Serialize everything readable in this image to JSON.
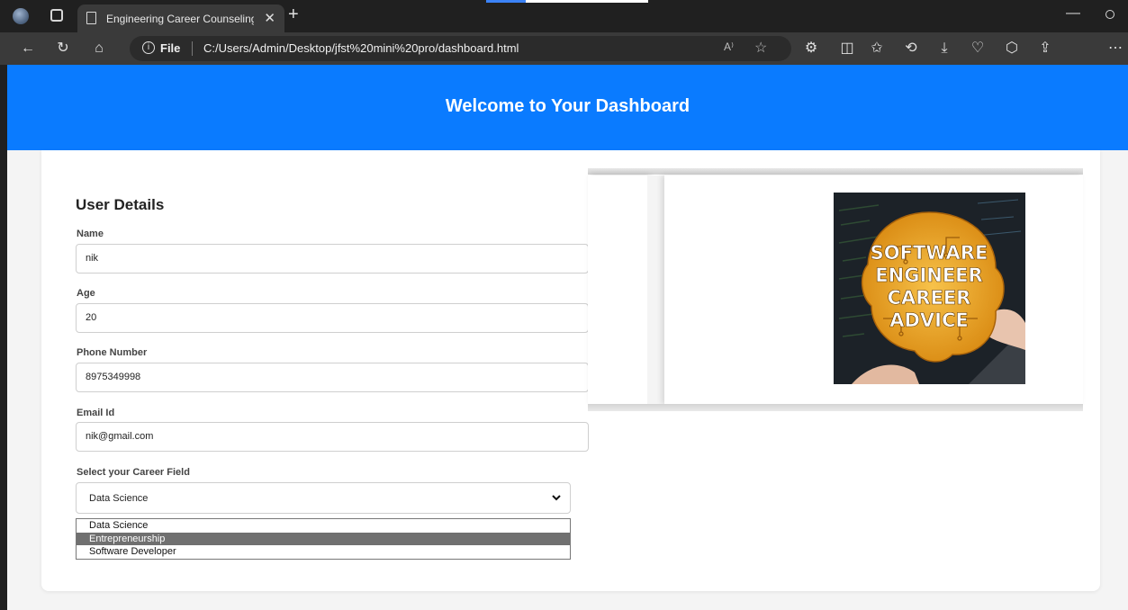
{
  "browser": {
    "tab_title": "Engineering Career Counseling D",
    "tab_close": "✕",
    "new_tab": "+",
    "file_label": "File",
    "url": "C:/Users/Admin/Desktop/jfst%20mini%20pro/dashboard.html",
    "icons": [
      "back-icon",
      "refresh-icon",
      "home-icon",
      "read-aloud-icon",
      "favorite-icon",
      "extensions-icon",
      "split-screen-icon",
      "favorites-icon",
      "history-icon",
      "downloads-icon",
      "performance-icon",
      "browser-essentials-icon",
      "share-icon",
      "more-icon"
    ]
  },
  "page": {
    "header_title": "Welcome to Your Dashboard",
    "header_color": "#0a7bff",
    "details_title": "User Details",
    "fields": {
      "name_label": "Name",
      "name_value": "nik",
      "age_label": "Age",
      "age_value": "20",
      "phone_label": "Phone Number",
      "phone_value": "8975349998",
      "email_label": "Email Id",
      "email_value": "nik@gmail.com"
    },
    "career": {
      "label": "Select your Career Field",
      "selected": "Data Science",
      "options": [
        "Data Science",
        "Entrepreneurship",
        "Software Developer"
      ],
      "highlighted_option": "Entrepreneurship"
    },
    "image": {
      "lines": [
        "SOFTWARE",
        "ENGINEER",
        "CAREER",
        "ADVICE"
      ]
    }
  }
}
